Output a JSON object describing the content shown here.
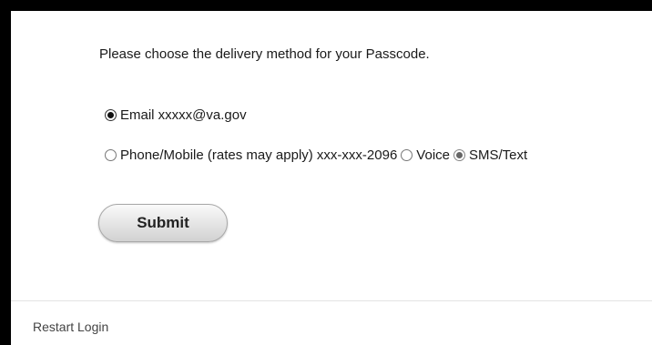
{
  "form": {
    "prompt": "Please choose the delivery method for your Passcode.",
    "email_option": {
      "label": "Email xxxxx@va.gov",
      "selected": true
    },
    "phone_option": {
      "label": "Phone/Mobile (rates may apply) xxx-xxx-2096",
      "selected": false,
      "sub_options": [
        {
          "label": "Voice",
          "selected": false
        },
        {
          "label": "SMS/Text",
          "selected": true
        }
      ]
    },
    "submit_label": "Submit"
  },
  "footer": {
    "restart_label": "Restart Login"
  },
  "colors": {
    "frame": "#000000",
    "panel": "#ffffff",
    "text": "#1a1a1a",
    "divider": "#e3e3e3",
    "footer_link": "#444444"
  }
}
